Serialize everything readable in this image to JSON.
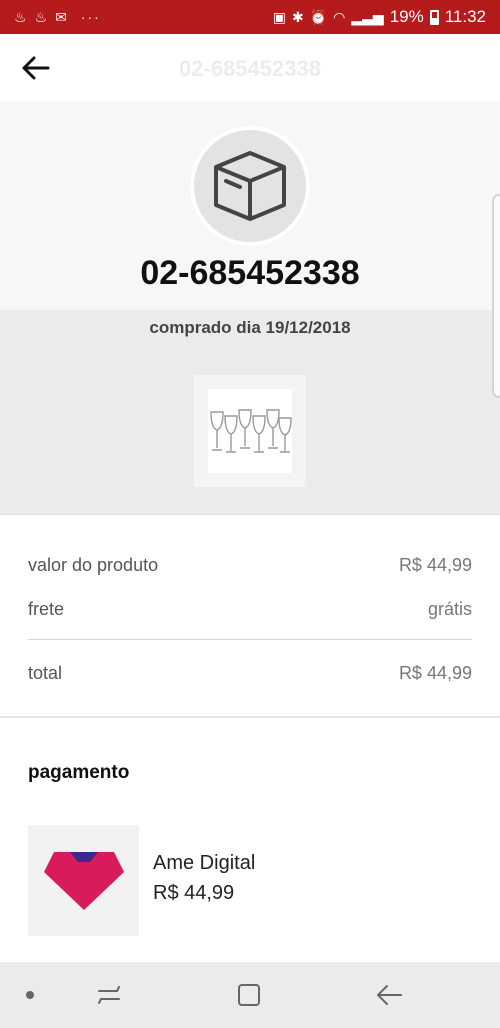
{
  "status_bar": {
    "left_icons": [
      "♨",
      "♨",
      "✉"
    ],
    "dots": "···",
    "battery_percent": "19%",
    "time": "11:32"
  },
  "app_bar": {
    "title": "02-685452338"
  },
  "order": {
    "number": "02-685452338",
    "purchase_date": "comprado dia 19/12/2018"
  },
  "summary": {
    "product_label": "valor do produto",
    "product_value": "R$ 44,99",
    "shipping_label": "frete",
    "shipping_value": "grátis",
    "total_label": "total",
    "total_value": "R$ 44,99"
  },
  "payment": {
    "title": "pagamento",
    "method_name": "Ame Digital",
    "amount": "R$ 44,99"
  },
  "colors": {
    "status_bar": "#b51b1b",
    "ame_red": "#d81b5a",
    "ame_blue": "#3a2a8f"
  }
}
